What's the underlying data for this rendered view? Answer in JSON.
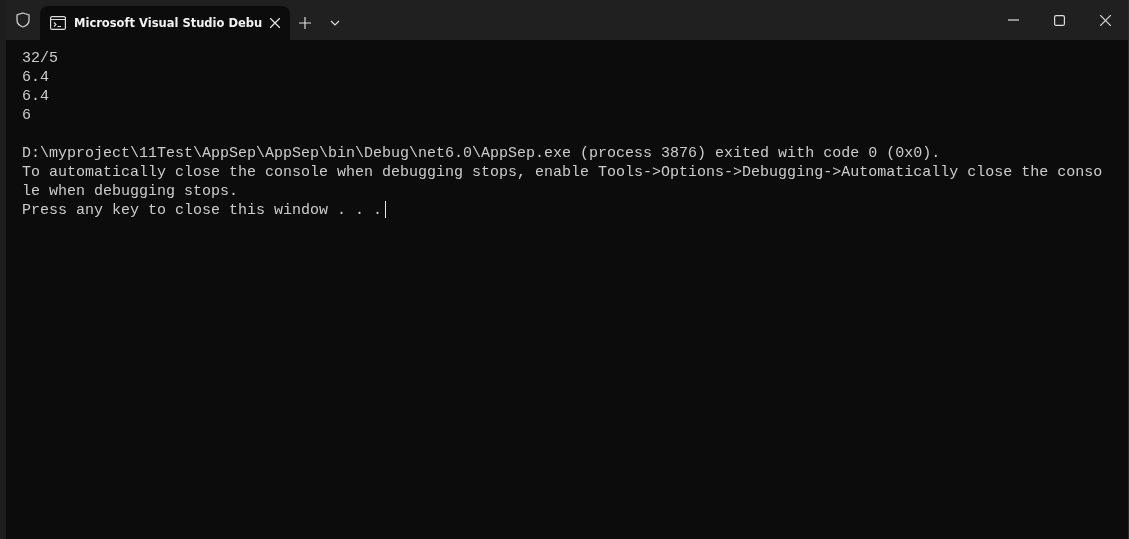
{
  "window": {
    "tabs": [
      {
        "title": "Microsoft Visual Studio Debu",
        "selected": true
      }
    ]
  },
  "console": {
    "blocks": [
      [
        "32/5",
        "6.4",
        "6.4",
        "6"
      ],
      [
        "D:\\myproject\\11Test\\AppSep\\AppSep\\bin\\Debug\\net6.0\\AppSep.exe (process 3876) exited with code 0 (0x0).",
        "To automatically close the console when debugging stops, enable Tools->Options->Debugging->Automatically close the conso",
        "le when debugging stops.",
        "Press any key to close this window . . ."
      ]
    ],
    "cursor_visible": true
  }
}
